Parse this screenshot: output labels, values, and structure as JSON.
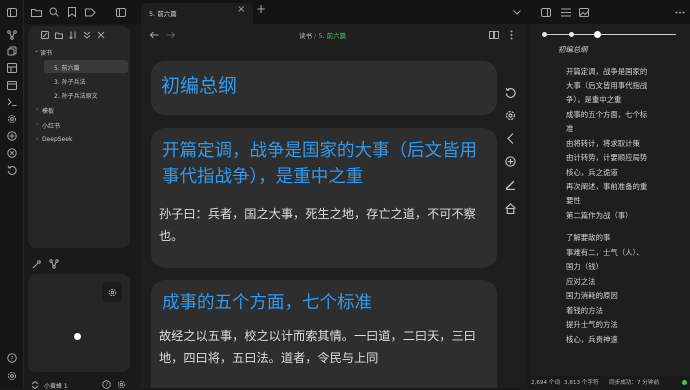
{
  "tab": {
    "title": "5. 前六篇",
    "close": "×",
    "add": "+"
  },
  "header": {
    "crumb_parent": "读书",
    "crumb_sep": " / ",
    "crumb_current": "5. 前六篇"
  },
  "tree": {
    "folder": "读书",
    "items": [
      "5. 前六篇",
      "3. 孙子兵法",
      "2. 孙子兵法原文"
    ],
    "folders": [
      "模板",
      "小红书",
      "DeepSeek"
    ]
  },
  "graph": {
    "label": "小黄蜂 1"
  },
  "doc": {
    "title": "初编总纲",
    "h2": "开篇定调，战争是国家的大事（后文皆用事代指战争），是重中之重",
    "p1": "孙子曰：兵者，国之大事，死生之地，存亡之道，不可不察也。",
    "h3": "成事的五个方面，七个标准",
    "p2": "故经之以五事，校之以计而索其情。一曰道，二曰天，三曰地，四曰将，五曰法。道者，令民与上同"
  },
  "outline": [
    "初编总纲",
    "开篇定调，战争是国家的",
    "大事（后文皆用事代指战",
    "争），是重中之重",
    "成事的五个方面，七个标",
    "准",
    "由将转计，将求取计策",
    "由计转势，计要顺应局势",
    "核心，兵之诡道",
    "再次阐述，事前准备的重",
    "要性",
    "第二篇作为战（事）",
    "了解要敌的事",
    "事难有二，士气（人）、",
    "国力（钱）",
    "应对之法",
    "国力消耗的原因",
    "着钱的方法",
    "提升士气的方法",
    "核心，兵贵神速"
  ],
  "status": {
    "words": "2,694 个词",
    "chars": "3,813 个字符",
    "sync": "同步成功：7 分钟前"
  },
  "colors": {
    "accent": "#2f9bf0",
    "sync_dot": "#3ec46d",
    "breadcrumb_current": "#4cc27a"
  }
}
